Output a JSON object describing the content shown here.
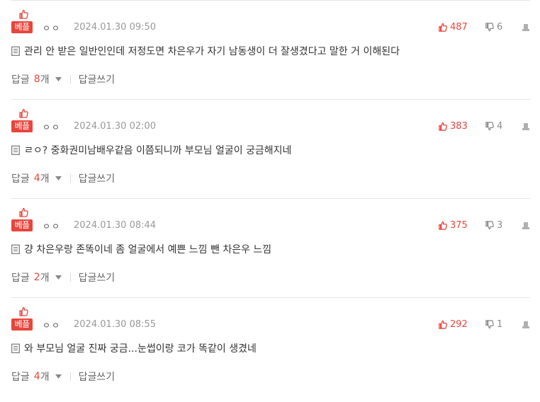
{
  "colors": {
    "accent": "#e8453c",
    "muted": "#999999",
    "border": "#e6e6e6"
  },
  "comments": [
    {
      "badge": "베플",
      "nickname": "ㅇㅇ",
      "date": "2024.01.30 09:50",
      "upvotes": "487",
      "downvotes": "6",
      "text": "관리 안 받은 일반인인데 저정도면 차은우가 자기 남동생이 더 잘생겼다고 말한 거 이해된다",
      "reply_label": "답글",
      "reply_count": "8",
      "reply_unit": "개",
      "write_reply": "답글쓰기"
    },
    {
      "badge": "베플",
      "nickname": "ㅇㅇ",
      "date": "2024.01.30 02:00",
      "upvotes": "383",
      "downvotes": "4",
      "text": "ㄹㅇ? 중화권미남배우같음 이쯤되니까 부모님 얼굴이 궁금해지네",
      "reply_label": "답글",
      "reply_count": "4",
      "reply_unit": "개",
      "write_reply": "답글쓰기"
    },
    {
      "badge": "베플",
      "nickname": "ㅇㅇ",
      "date": "2024.01.30 08:44",
      "upvotes": "375",
      "downvotes": "3",
      "text": "걍 차은우랑 존똑이네 좀 얼굴에서 예쁜 느낌 뺀 차은우 느낌",
      "reply_label": "답글",
      "reply_count": "2",
      "reply_unit": "개",
      "write_reply": "답글쓰기"
    },
    {
      "badge": "베플",
      "nickname": "ㅇㅇ",
      "date": "2024.01.30 08:55",
      "upvotes": "292",
      "downvotes": "1",
      "text": "와 부모님 얼굴 진짜 궁금...눈썹이랑 코가 똑같이 생겼네",
      "reply_label": "답글",
      "reply_count": "4",
      "reply_unit": "개",
      "write_reply": "답글쓰기"
    }
  ]
}
